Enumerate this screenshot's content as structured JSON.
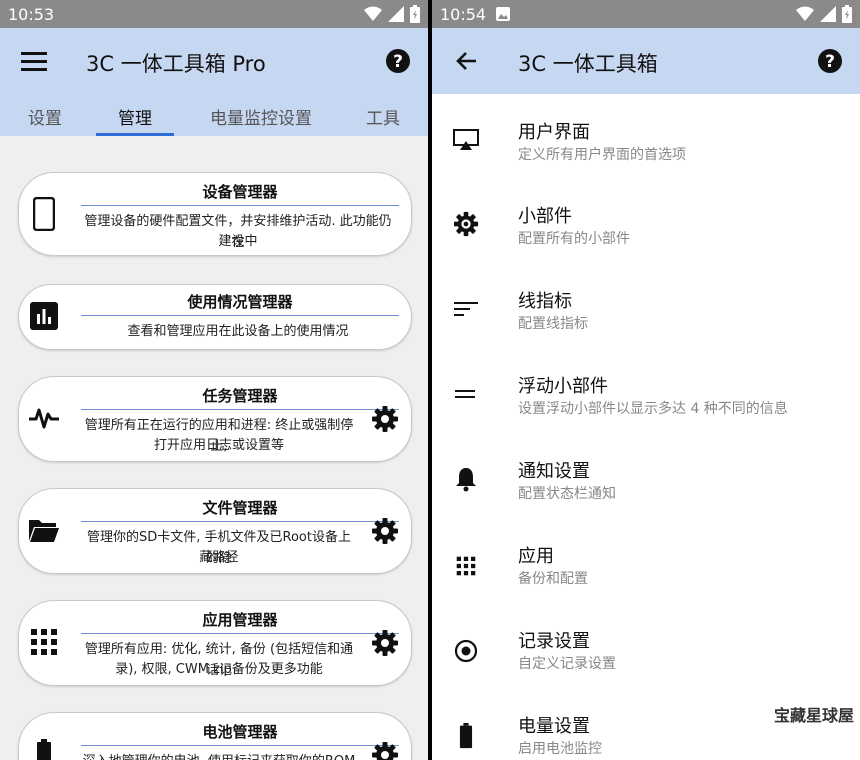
{
  "left": {
    "status": {
      "time": "10:53"
    },
    "appbar": {
      "title": "3C 一体工具箱 Pro"
    },
    "tabs": [
      {
        "label": "设置"
      },
      {
        "label": "管理"
      },
      {
        "label": "电量监控设置"
      },
      {
        "label": "工具"
      }
    ],
    "cards": [
      {
        "title": "设备管理器",
        "desc1": "管理设备的硬件配置文件，并安排维护活动. 此功能仍在",
        "desc2": "建设中",
        "icon": "phone-icon"
      },
      {
        "title": "使用情况管理器",
        "desc1": "查看和管理应用在此设备上的使用情况",
        "desc2": "",
        "icon": "bar-chart-icon"
      },
      {
        "title": "任务管理器",
        "desc1": "管理所有正在运行的应用和进程: 终止或强制停止,",
        "desc2": "打开应用日志或设置等",
        "icon": "pulse-icon"
      },
      {
        "title": "文件管理器",
        "desc1": "管理你的SD卡文件, 手机文件及已Root设备上的隐",
        "desc2": "藏路径",
        "icon": "folder-icon"
      },
      {
        "title": "应用管理器",
        "desc1": "管理所有应用: 优化, 统计, 备份 (包括短信和通话记",
        "desc2": "录), 权限, CWM zip备份及更多功能",
        "icon": "apps-grid-icon"
      },
      {
        "title": "电池管理器",
        "desc1": "深入地管理你的电池, 使用标记来获取你的ROM和",
        "desc2": "",
        "icon": "battery-icon"
      }
    ]
  },
  "right": {
    "status": {
      "time": "10:54"
    },
    "appbar": {
      "title": "3C 一体工具箱"
    },
    "items": [
      {
        "title": "用户界面",
        "sub": "定义所有用户界面的首选项",
        "icon": "cast-screen-icon"
      },
      {
        "title": "小部件",
        "sub": "配置所有的小部件",
        "icon": "widget-gear-icon"
      },
      {
        "title": "线指标",
        "sub": "配置线指标",
        "icon": "lines-icon"
      },
      {
        "title": "浮动小部件",
        "sub": "设置浮动小部件以显示多达 4 种不同的信息",
        "icon": "floating-lines-icon"
      },
      {
        "title": "通知设置",
        "sub": "配置状态栏通知",
        "icon": "bell-icon"
      },
      {
        "title": "应用",
        "sub": "备份和配置",
        "icon": "apps-grid-icon"
      },
      {
        "title": "记录设置",
        "sub": "自定义记录设置",
        "icon": "record-icon"
      },
      {
        "title": "电量设置",
        "sub": "启用电池监控",
        "icon": "battery-icon"
      }
    ]
  },
  "watermark": "宝藏星球屋"
}
